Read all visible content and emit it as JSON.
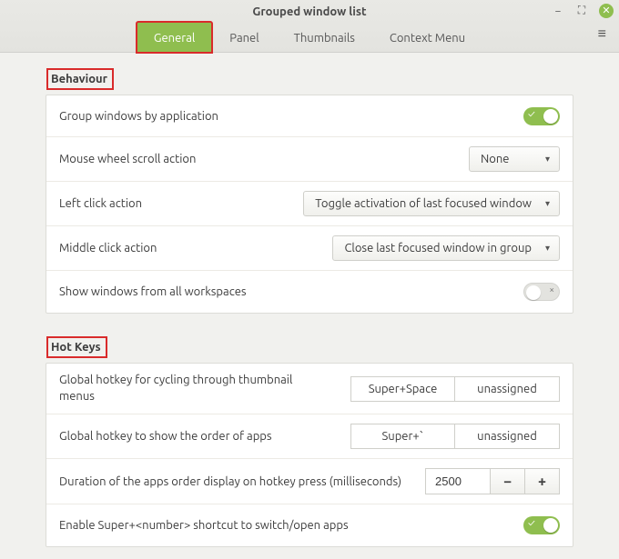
{
  "window": {
    "title": "Grouped window list"
  },
  "tabs": {
    "general": "General",
    "panel": "Panel",
    "thumbnails": "Thumbnails",
    "context_menu": "Context Menu"
  },
  "sections": {
    "behaviour": {
      "heading": "Behaviour",
      "group_windows": "Group windows by application",
      "mouse_wheel_label": "Mouse wheel scroll action",
      "mouse_wheel_value": "None",
      "left_click_label": "Left click action",
      "left_click_value": "Toggle activation of last focused window",
      "middle_click_label": "Middle click action",
      "middle_click_value": "Close last focused window in group",
      "show_all_ws": "Show windows from all workspaces"
    },
    "hotkeys": {
      "heading": "Hot Keys",
      "cycle_label": "Global hotkey for cycling through thumbnail menus",
      "cycle_k1": "Super+Space",
      "cycle_k2": "unassigned",
      "order_label": "Global hotkey to show the order of apps",
      "order_k1": "Super+`",
      "order_k2": "unassigned",
      "duration_label": "Duration of the apps order display on hotkey press (milliseconds)",
      "duration_value": "2500",
      "super_num": "Enable Super+<number> shortcut to switch/open apps"
    }
  },
  "glyphs": {
    "minimize": "−",
    "maximize": "⛶",
    "close": "✕",
    "menu": "≡",
    "caret": "▾",
    "check": "✓",
    "x": "×",
    "minus": "−",
    "plus": "+"
  }
}
